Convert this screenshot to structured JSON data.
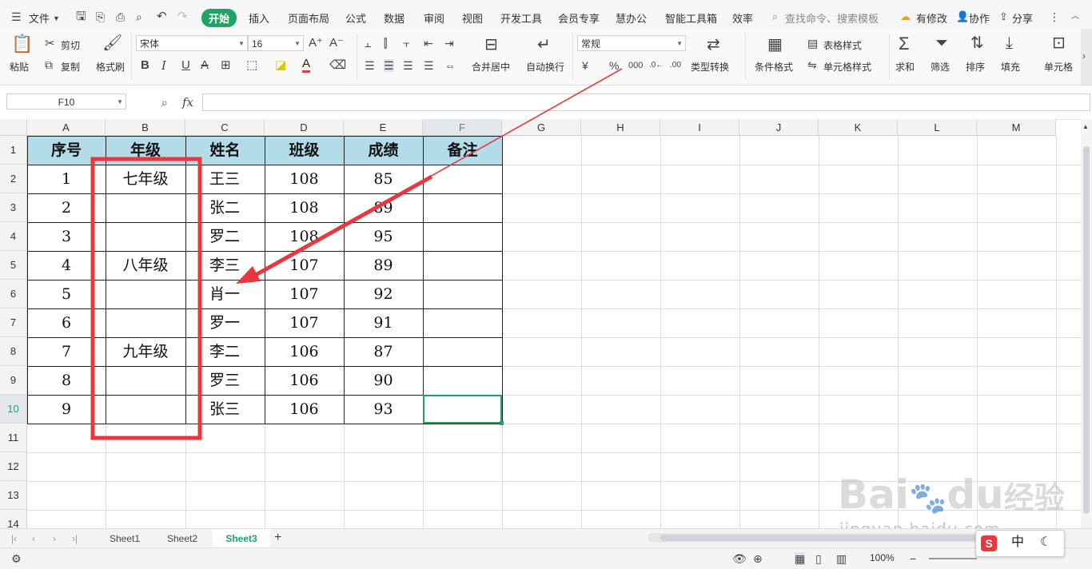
{
  "menu": {
    "file_label": "文件",
    "tabs": [
      "开始",
      "插入",
      "页面布局",
      "公式",
      "数据",
      "审阅",
      "视图",
      "开发工具",
      "会员专享",
      "慧办公",
      "智能工具箱",
      "效率"
    ],
    "search_placeholder": "查找命令、搜索模板",
    "right": {
      "modify": "有修改",
      "collab": "协作",
      "share": "分享"
    }
  },
  "ribbon": {
    "paste": "粘贴",
    "cut": "剪切",
    "copy": "复制",
    "format_painter": "格式刷",
    "font_name": "宋体",
    "font_size": "16",
    "merge": "合并居中",
    "wrap": "自动换行",
    "number_format": "常规",
    "type_convert": "类型转换",
    "cond_format": "条件格式",
    "table_style": "表格样式",
    "cell_style": "单元格样式",
    "sum": "求和",
    "filter": "筛选",
    "sort": "排序",
    "fill": "填充",
    "cell": "单元格",
    "bold": "B",
    "italic": "I",
    "underline": "U",
    "strike": "A"
  },
  "formula_bar": {
    "name_box": "F10",
    "fx": "fx",
    "value": ""
  },
  "columns": [
    "A",
    "B",
    "C",
    "D",
    "E",
    "F",
    "G",
    "H",
    "I",
    "J",
    "K",
    "L",
    "M"
  ],
  "rows": [
    "1",
    "2",
    "3",
    "4",
    "5",
    "6",
    "7",
    "8",
    "9",
    "10",
    "11",
    "12",
    "13",
    "14"
  ],
  "table": {
    "headers": [
      "序号",
      "年级",
      "姓名",
      "班级",
      "成绩",
      "备注"
    ],
    "grades": [
      "七年级",
      "八年级",
      "九年级"
    ],
    "data": [
      [
        "1",
        "王三",
        "108",
        "85"
      ],
      [
        "2",
        "张二",
        "108",
        "89"
      ],
      [
        "3",
        "罗二",
        "108",
        "95"
      ],
      [
        "4",
        "李三",
        "107",
        "89"
      ],
      [
        "5",
        "肖一",
        "107",
        "92"
      ],
      [
        "6",
        "罗一",
        "107",
        "91"
      ],
      [
        "7",
        "李二",
        "106",
        "87"
      ],
      [
        "8",
        "罗三",
        "106",
        "90"
      ],
      [
        "9",
        "张三",
        "106",
        "93"
      ]
    ]
  },
  "sheets": [
    "Sheet1",
    "Sheet2",
    "Sheet3"
  ],
  "active_sheet": "Sheet3",
  "status": {
    "zoom": "100%"
  },
  "watermark": {
    "text1": "Bai",
    "text2": "du",
    "text3": "经验",
    "url": "jingyan.baidu.com"
  },
  "ime": {
    "zh": "中"
  },
  "colors": {
    "accent": "#21a366",
    "header_fill": "#b4dce8",
    "annotation": "#e8383d"
  }
}
